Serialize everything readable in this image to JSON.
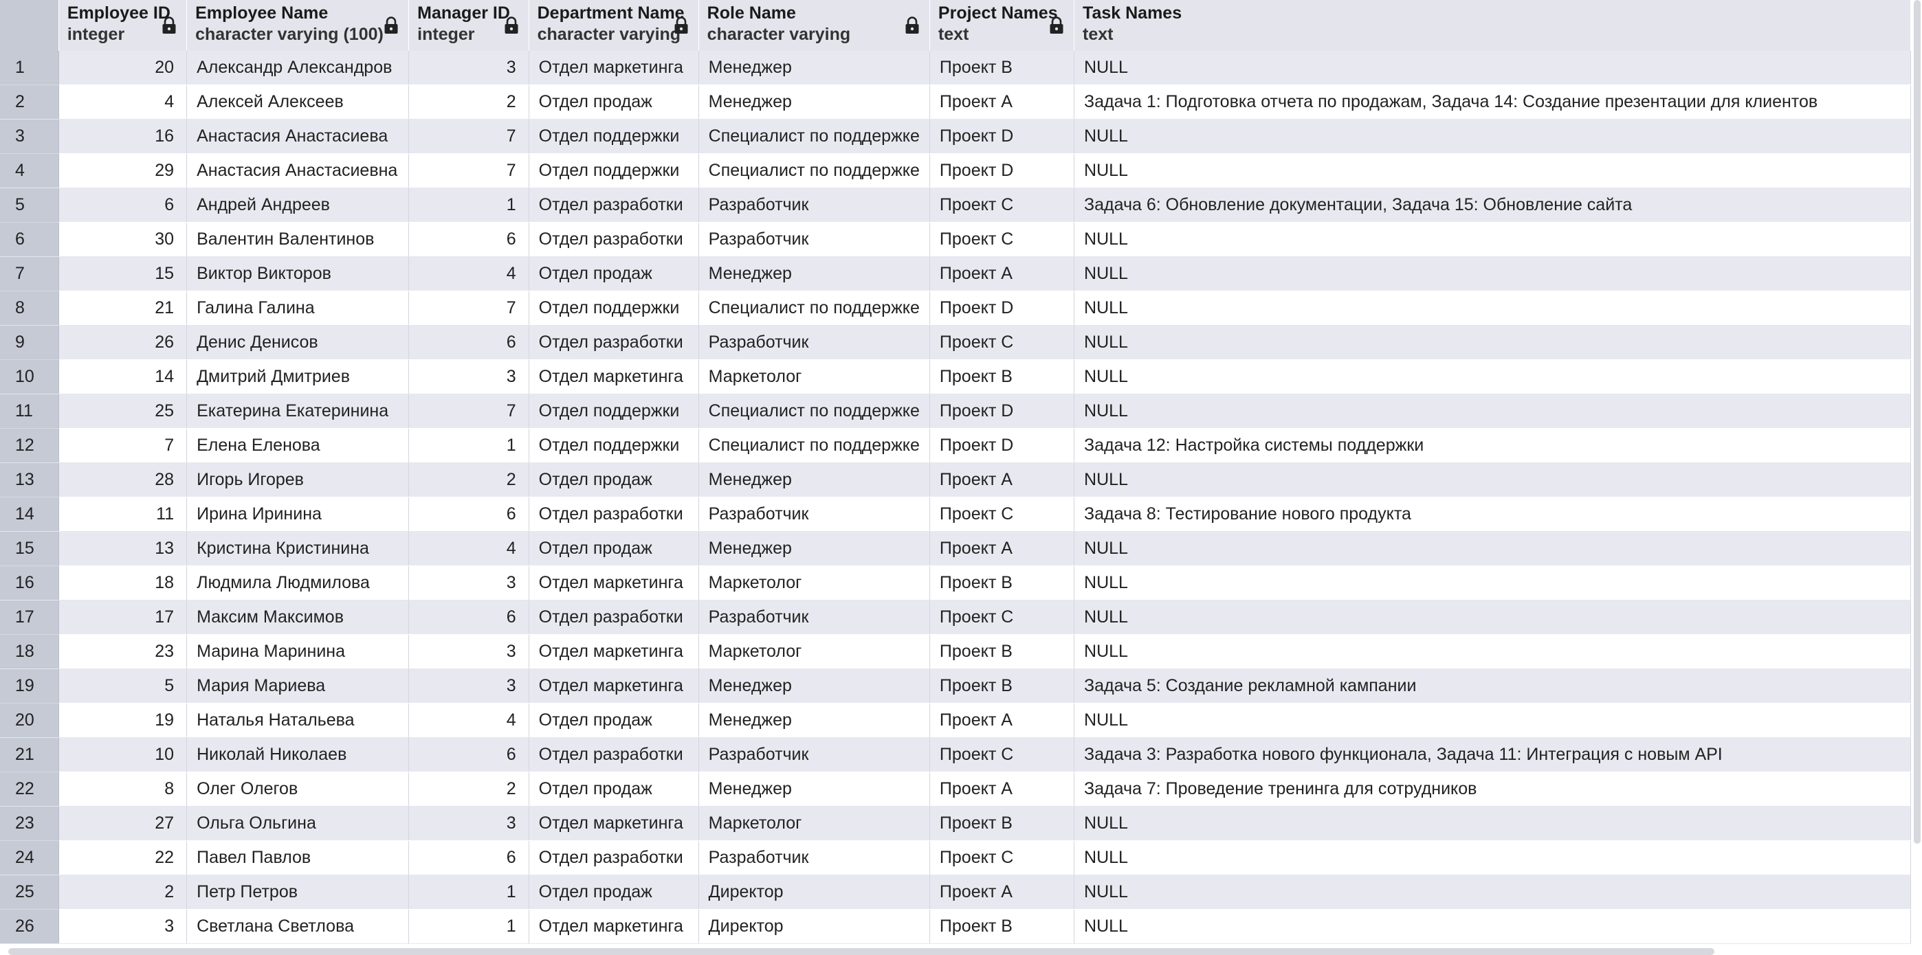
{
  "columns": [
    {
      "name": "Employee ID",
      "type": "integer",
      "locked": true
    },
    {
      "name": "Employee Name",
      "type": "character varying (100)",
      "locked": true
    },
    {
      "name": "Manager ID",
      "type": "integer",
      "locked": true
    },
    {
      "name": "Department Name",
      "type": "character varying",
      "locked": true
    },
    {
      "name": "Role Name",
      "type": "character varying",
      "locked": true
    },
    {
      "name": "Project Names",
      "type": "text",
      "locked": true
    },
    {
      "name": "Task Names",
      "type": "text",
      "locked": false
    }
  ],
  "rows": [
    {
      "n": "1",
      "id": "20",
      "name": "Александр Александров",
      "mgr": "3",
      "dept": "Отдел маркетинга",
      "role": "Менеджер",
      "proj": "Проект B",
      "task": "NULL"
    },
    {
      "n": "2",
      "id": "4",
      "name": "Алексей Алексеев",
      "mgr": "2",
      "dept": "Отдел продаж",
      "role": "Менеджер",
      "proj": "Проект A",
      "task": "Задача 1: Подготовка отчета по продажам, Задача 14: Создание презентации для клиентов"
    },
    {
      "n": "3",
      "id": "16",
      "name": "Анастасия Анастасиева",
      "mgr": "7",
      "dept": "Отдел поддержки",
      "role": "Специалист по поддержке",
      "proj": "Проект D",
      "task": "NULL"
    },
    {
      "n": "4",
      "id": "29",
      "name": "Анастасия Анастасиевна",
      "mgr": "7",
      "dept": "Отдел поддержки",
      "role": "Специалист по поддержке",
      "proj": "Проект D",
      "task": "NULL"
    },
    {
      "n": "5",
      "id": "6",
      "name": "Андрей Андреев",
      "mgr": "1",
      "dept": "Отдел разработки",
      "role": "Разработчик",
      "proj": "Проект C",
      "task": "Задача 6: Обновление документации, Задача 15: Обновление сайта"
    },
    {
      "n": "6",
      "id": "30",
      "name": "Валентин Валентинов",
      "mgr": "6",
      "dept": "Отдел разработки",
      "role": "Разработчик",
      "proj": "Проект C",
      "task": "NULL"
    },
    {
      "n": "7",
      "id": "15",
      "name": "Виктор Викторов",
      "mgr": "4",
      "dept": "Отдел продаж",
      "role": "Менеджер",
      "proj": "Проект A",
      "task": "NULL"
    },
    {
      "n": "8",
      "id": "21",
      "name": "Галина Галина",
      "mgr": "7",
      "dept": "Отдел поддержки",
      "role": "Специалист по поддержке",
      "proj": "Проект D",
      "task": "NULL"
    },
    {
      "n": "9",
      "id": "26",
      "name": "Денис Денисов",
      "mgr": "6",
      "dept": "Отдел разработки",
      "role": "Разработчик",
      "proj": "Проект C",
      "task": "NULL"
    },
    {
      "n": "10",
      "id": "14",
      "name": "Дмитрий Дмитриев",
      "mgr": "3",
      "dept": "Отдел маркетинга",
      "role": "Маркетолог",
      "proj": "Проект B",
      "task": "NULL"
    },
    {
      "n": "11",
      "id": "25",
      "name": "Екатерина Екатеринина",
      "mgr": "7",
      "dept": "Отдел поддержки",
      "role": "Специалист по поддержке",
      "proj": "Проект D",
      "task": "NULL"
    },
    {
      "n": "12",
      "id": "7",
      "name": "Елена Еленова",
      "mgr": "1",
      "dept": "Отдел поддержки",
      "role": "Специалист по поддержке",
      "proj": "Проект D",
      "task": "Задача 12: Настройка системы поддержки"
    },
    {
      "n": "13",
      "id": "28",
      "name": "Игорь Игорев",
      "mgr": "2",
      "dept": "Отдел продаж",
      "role": "Менеджер",
      "proj": "Проект A",
      "task": "NULL"
    },
    {
      "n": "14",
      "id": "11",
      "name": "Ирина Иринина",
      "mgr": "6",
      "dept": "Отдел разработки",
      "role": "Разработчик",
      "proj": "Проект C",
      "task": "Задача 8: Тестирование нового продукта"
    },
    {
      "n": "15",
      "id": "13",
      "name": "Кристина Кристинина",
      "mgr": "4",
      "dept": "Отдел продаж",
      "role": "Менеджер",
      "proj": "Проект A",
      "task": "NULL"
    },
    {
      "n": "16",
      "id": "18",
      "name": "Людмила Людмилова",
      "mgr": "3",
      "dept": "Отдел маркетинга",
      "role": "Маркетолог",
      "proj": "Проект B",
      "task": "NULL"
    },
    {
      "n": "17",
      "id": "17",
      "name": "Максим Максимов",
      "mgr": "6",
      "dept": "Отдел разработки",
      "role": "Разработчик",
      "proj": "Проект C",
      "task": "NULL"
    },
    {
      "n": "18",
      "id": "23",
      "name": "Марина Маринина",
      "mgr": "3",
      "dept": "Отдел маркетинга",
      "role": "Маркетолог",
      "proj": "Проект B",
      "task": "NULL"
    },
    {
      "n": "19",
      "id": "5",
      "name": "Мария Мариева",
      "mgr": "3",
      "dept": "Отдел маркетинга",
      "role": "Менеджер",
      "proj": "Проект B",
      "task": "Задача 5: Создание рекламной кампании"
    },
    {
      "n": "20",
      "id": "19",
      "name": "Наталья Натальева",
      "mgr": "4",
      "dept": "Отдел продаж",
      "role": "Менеджер",
      "proj": "Проект A",
      "task": "NULL"
    },
    {
      "n": "21",
      "id": "10",
      "name": "Николай Николаев",
      "mgr": "6",
      "dept": "Отдел разработки",
      "role": "Разработчик",
      "proj": "Проект C",
      "task": "Задача 3: Разработка нового функционала, Задача 11: Интеграция с новым API"
    },
    {
      "n": "22",
      "id": "8",
      "name": "Олег Олегов",
      "mgr": "2",
      "dept": "Отдел продаж",
      "role": "Менеджер",
      "proj": "Проект A",
      "task": "Задача 7: Проведение тренинга для сотрудников"
    },
    {
      "n": "23",
      "id": "27",
      "name": "Ольга Ольгина",
      "mgr": "3",
      "dept": "Отдел маркетинга",
      "role": "Маркетолог",
      "proj": "Проект B",
      "task": "NULL"
    },
    {
      "n": "24",
      "id": "22",
      "name": "Павел Павлов",
      "mgr": "6",
      "dept": "Отдел разработки",
      "role": "Разработчик",
      "proj": "Проект C",
      "task": "NULL"
    },
    {
      "n": "25",
      "id": "2",
      "name": "Петр Петров",
      "mgr": "1",
      "dept": "Отдел продаж",
      "role": "Директор",
      "proj": "Проект A",
      "task": "NULL"
    },
    {
      "n": "26",
      "id": "3",
      "name": "Светлана Светлова",
      "mgr": "1",
      "dept": "Отдел маркетинга",
      "role": "Директор",
      "proj": "Проект B",
      "task": "NULL"
    }
  ]
}
